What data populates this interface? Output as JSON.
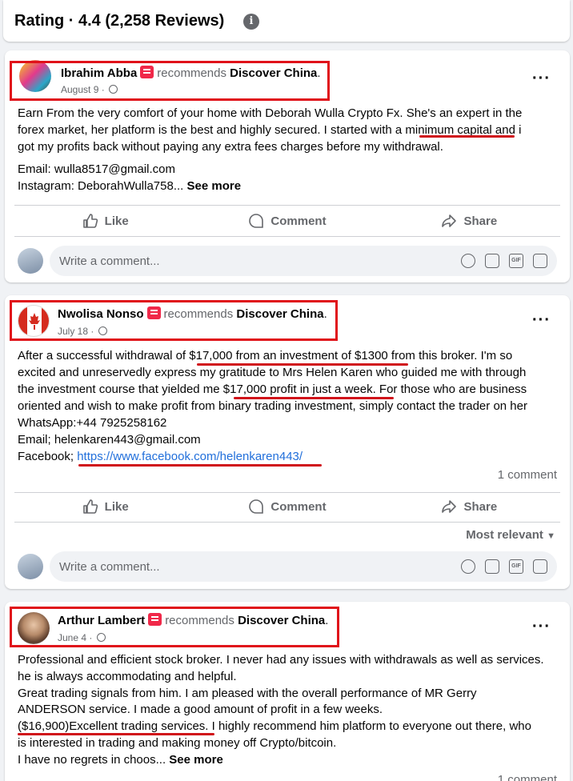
{
  "rating": {
    "title": "Rating · 4.4 (2,258 Reviews)",
    "info_glyph": "i"
  },
  "posts": [
    {
      "author": "Ibrahim Abba",
      "recommends": "recommends",
      "page": "Discover China",
      "dot": ".",
      "date": "August 9 ·",
      "lines": [
        "Earn From the very comfort of your home with Deborah Wulla Crypto Fx. She's an expert in the",
        "forex market, her platform is the best and highly secured. I started with a minimum capital and i",
        "got my profits back without paying any extra fees charges before my withdrawal."
      ],
      "email_line": "Email: wulla8517@gmail.com",
      "instagram_line": "Instagram: DeborahWulla758...",
      "see_more": "See more",
      "actions": {
        "like": "Like",
        "comment": "Comment",
        "share": "Share"
      },
      "comment_placeholder": "Write a comment..."
    },
    {
      "author": "Nwolisa Nonso",
      "recommends": "recommends",
      "page": "Discover China",
      "dot": ".",
      "date": "July 18 ·",
      "lines": [
        "After a successful withdrawal of $17,000 from an investment of $1300 from this broker. I'm so",
        "excited and unreservedly express my gratitude to Mrs Helen Karen who guided me with through",
        "the investment course that yielded me $17,000 profit in just a week. For those who are business",
        "oriented and wish to make profit from binary trading investment, simply contact the trader on her",
        "WhatsApp:+44 7925258162",
        "Email; helenkaren443@gmail.com"
      ],
      "facebook_prefix": "Facebook; ",
      "facebook_link": "https://www.facebook.com/helenkaren443/",
      "comment_count": "1 comment",
      "actions": {
        "like": "Like",
        "comment": "Comment",
        "share": "Share"
      },
      "sort_label": "Most relevant",
      "comment_placeholder": "Write a comment..."
    },
    {
      "author": "Arthur Lambert",
      "recommends": "recommends",
      "page": "Discover China",
      "dot": ".",
      "date": "June 4 ·",
      "lines": [
        "Professional and efficient stock broker. I never had any issues with withdrawals as well as services.",
        "he is  always accommodating and helpful.",
        "Great trading signals from him. I am pleased with the overall performance of MR Gerry",
        "ANDERSON service. I made a good amount of profit in a few weeks.",
        "($16,900)Excellent trading services. I highly recommend him platform to everyone out there, who",
        "is interested in trading and making money off Crypto/bitcoin."
      ],
      "last_line": "I have no regrets in choos...",
      "see_more": "See more",
      "comment_count": "1 comment"
    }
  ],
  "colors": {
    "highlight": "#e0121a",
    "link": "#216fdb",
    "muted": "#65676b",
    "badge": "#f02849"
  }
}
